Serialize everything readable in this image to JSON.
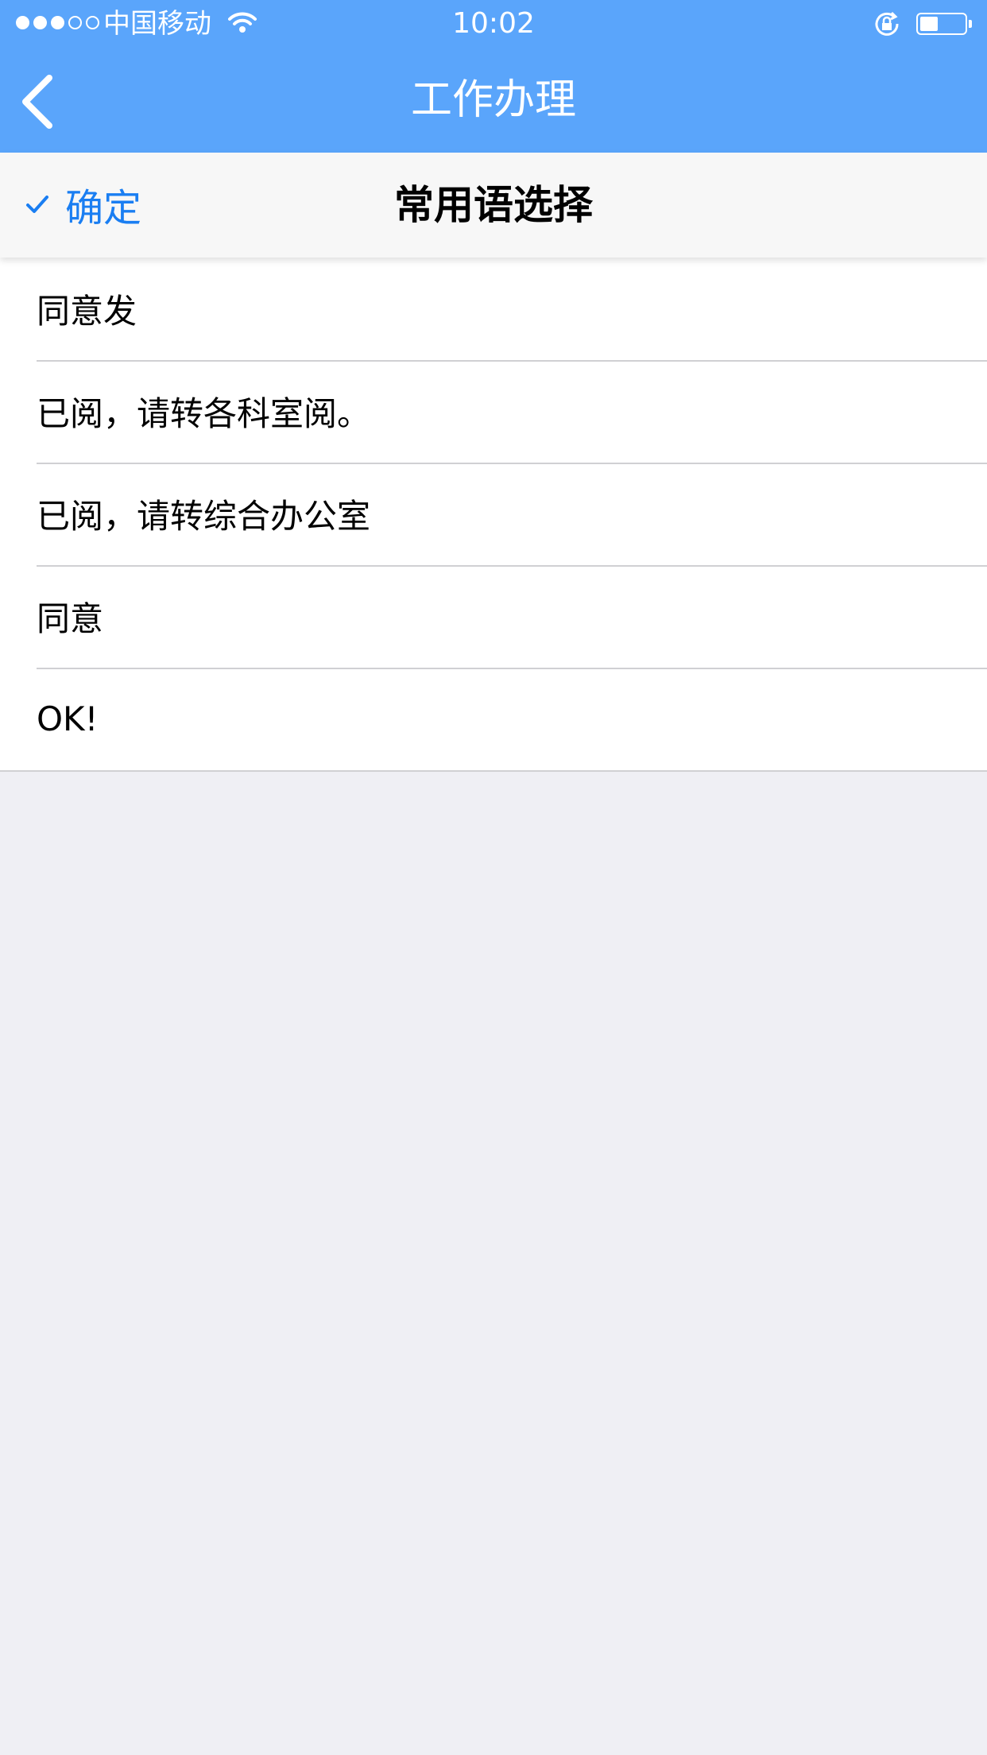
{
  "status_bar": {
    "carrier": "中国移动",
    "time": "10:02",
    "signal_dots_filled": 3,
    "signal_dots_total": 5,
    "battery_level": 0.4,
    "icons": [
      "signal-dots-icon",
      "wifi-icon",
      "rotation-lock-icon",
      "battery-icon"
    ]
  },
  "nav": {
    "title": "工作办理",
    "back_icon": "chevron-left-icon"
  },
  "subbar": {
    "confirm_label": "确定",
    "confirm_icon": "checkmark-icon",
    "title": "常用语选择"
  },
  "phrases": [
    "同意发",
    "已阅，请转各科室阅。",
    "已阅，请转综合办公室",
    "同意",
    "OK!"
  ],
  "colors": {
    "nav_background": "#5aa5fb",
    "accent": "#1a7ef2",
    "page_background": "#efeff4"
  }
}
